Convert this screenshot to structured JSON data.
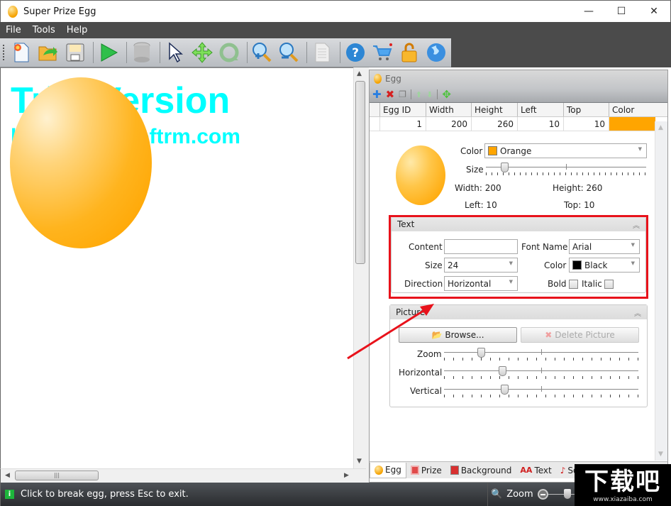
{
  "window": {
    "title": "Super Prize Egg",
    "minimize": "—",
    "maximize": "☐",
    "close": "✕"
  },
  "menu": [
    "File",
    "Tools",
    "Help"
  ],
  "toolbar": {
    "buttons": [
      "new-icon",
      "open-icon",
      "save-icon",
      "play-icon",
      "database-icon",
      "select-arrow-icon",
      "move-icon",
      "rotate-icon",
      "zoom-in-icon",
      "zoom-out-icon",
      "document-icon",
      "help-icon",
      "cart-icon",
      "unlock-icon",
      "globe-icon"
    ]
  },
  "canvas": {
    "watermark_line1": "Trial Version",
    "watermark_line2": "http://www.softrm.com",
    "egg_color": "#FFA500"
  },
  "egg_panel": {
    "title": "Egg",
    "tools": [
      "add",
      "delete",
      "copy",
      "move-up",
      "move-down",
      "move"
    ],
    "columns": [
      "Egg ID",
      "Width",
      "Height",
      "Left",
      "Top",
      "Color"
    ],
    "rows": [
      {
        "id": "1",
        "width": "200",
        "height": "260",
        "left": "10",
        "top": "10",
        "color": "#FFA500"
      }
    ],
    "color_label": "Color",
    "color_value": "Orange",
    "color_swatch": "#FFA500",
    "size_label": "Size",
    "size_value": 0.05,
    "width_text": "Width: 200",
    "height_text": "Height: 260",
    "left_text": "Left: 10",
    "top_text": "Top: 10"
  },
  "text_group": {
    "title": "Text",
    "content_label": "Content",
    "content_value": "",
    "font_name_label": "Font Name",
    "font_name_value": "Arial",
    "size_label": "Size",
    "size_value": "24",
    "color_label": "Color",
    "color_value": "Black",
    "color_swatch": "#000000",
    "direction_label": "Direction",
    "direction_value": "Horizontal",
    "bold_label": "Bold",
    "italic_label": "Italic",
    "bold_checked": false,
    "italic_checked": false
  },
  "picture_group": {
    "title": "Picture",
    "browse_label": "Browse...",
    "delete_label": "Delete Picture",
    "zoom_label": "Zoom",
    "horizontal_label": "Horizontal",
    "vertical_label": "Vertical",
    "zoom_value": 0.19,
    "horizontal_value": 0.3,
    "vertical_value": 0.31
  },
  "bottom_tabs": [
    "Egg",
    "Prize",
    "Background",
    "Text",
    "Sound"
  ],
  "status": {
    "message": "Click to break egg, press Esc to exit.",
    "zoom_label": "Zoom"
  },
  "overlay": {
    "site_name": "下载吧",
    "site_url": "www.xiazaiba.com"
  }
}
